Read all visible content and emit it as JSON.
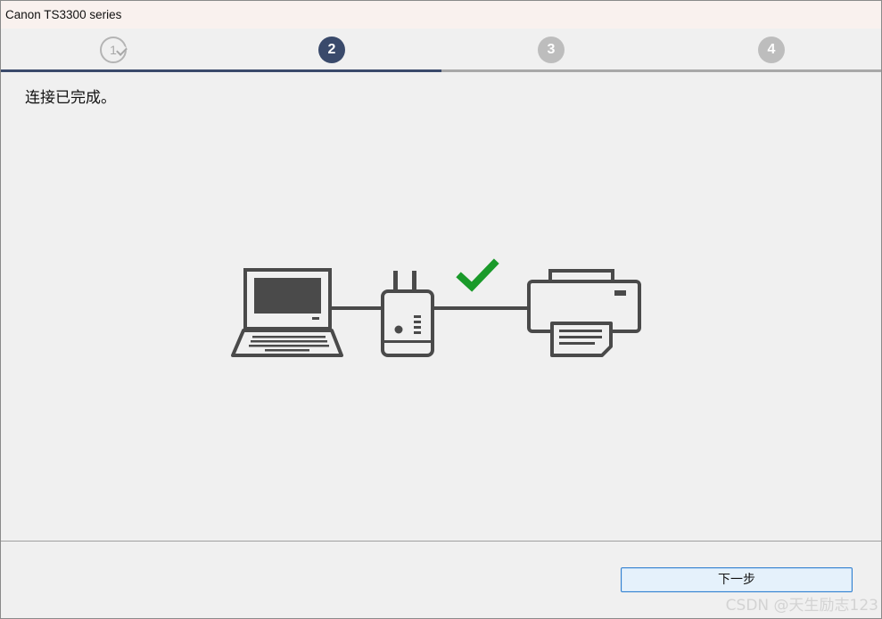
{
  "window": {
    "title": "Canon TS3300 series"
  },
  "steps": [
    {
      "number": "1",
      "state": "done"
    },
    {
      "number": "2",
      "state": "current"
    },
    {
      "number": "3",
      "state": "todo"
    },
    {
      "number": "4",
      "state": "todo"
    }
  ],
  "progress": {
    "current_step": 2,
    "total_steps": 4,
    "fraction": 0.5
  },
  "message": "连接已完成。",
  "illustration": {
    "devices": [
      "laptop-icon",
      "router-icon",
      "printer-icon"
    ],
    "status_icon": "checkmark-icon",
    "colors": {
      "device": "#4a4a4a",
      "check": "#1a9a2a"
    }
  },
  "footer": {
    "next_label": "下一步"
  },
  "watermark": "CSDN @天生励志123",
  "colors": {
    "accent": "#3a4a6b",
    "inactive": "#bdbdbd",
    "background": "#f0f0f0"
  }
}
